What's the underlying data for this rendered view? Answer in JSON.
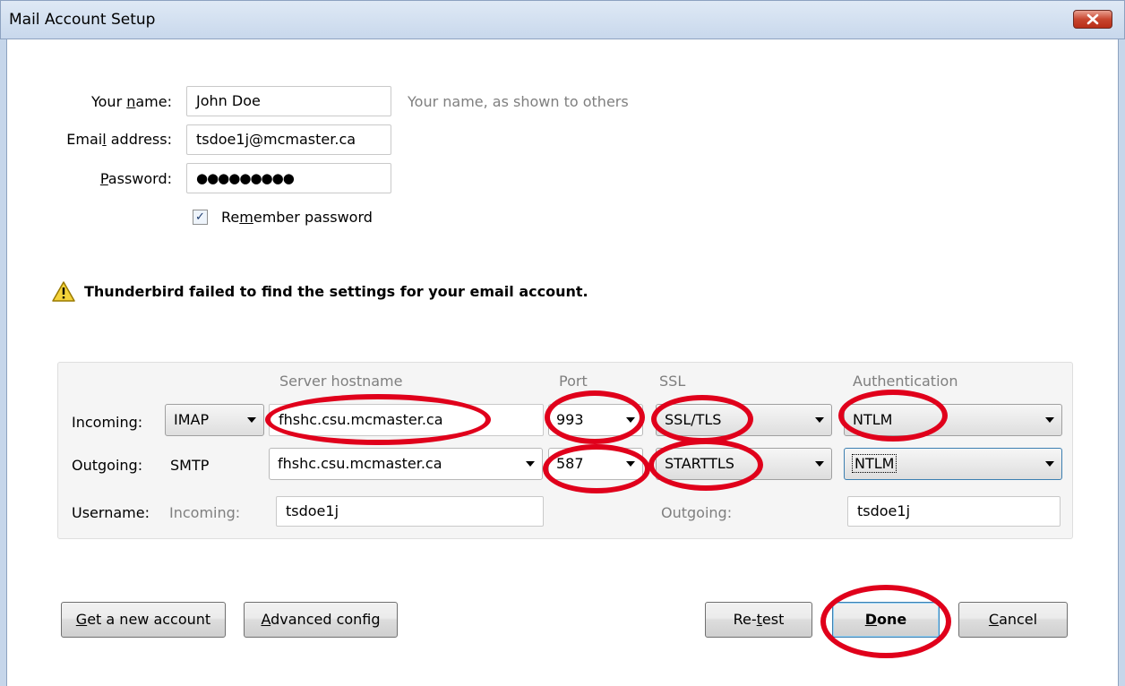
{
  "window": {
    "title": "Mail Account Setup",
    "close_icon": "close-icon"
  },
  "identity": {
    "name_label": "Your name:",
    "name_value": "John Doe",
    "name_hint": "Your name, as shown to others",
    "email_label": "Email address:",
    "email_value": "tsdoe1j@mcmaster.ca",
    "password_label": "Password:",
    "password_value": "●●●●●●●●●",
    "remember_label": "Remember password",
    "remember_checked": true
  },
  "warning": {
    "icon": "warning-icon",
    "text": "Thunderbird failed to find the settings for your email account."
  },
  "servers": {
    "headers": {
      "hostname": "Server hostname",
      "port": "Port",
      "ssl": "SSL",
      "auth": "Authentication"
    },
    "incoming": {
      "label": "Incoming:",
      "protocol": "IMAP",
      "hostname": "fhshc.csu.mcmaster.ca",
      "port": "993",
      "ssl": "SSL/TLS",
      "auth": "NTLM"
    },
    "outgoing": {
      "label": "Outgoing:",
      "protocol": "SMTP",
      "hostname": "fhshc.csu.mcmaster.ca",
      "port": "587",
      "ssl": "STARTTLS",
      "auth": "NTLM"
    },
    "username": {
      "label": "Username:",
      "incoming_label": "Incoming:",
      "incoming_value": "tsdoe1j",
      "outgoing_label": "Outgoing:",
      "outgoing_value": "tsdoe1j"
    }
  },
  "buttons": {
    "new_account": "Get a new account",
    "advanced": "Advanced config",
    "retest": "Re-test",
    "done": "Done",
    "cancel": "Cancel"
  },
  "annotations": {
    "circle_color": "#e0001b"
  }
}
